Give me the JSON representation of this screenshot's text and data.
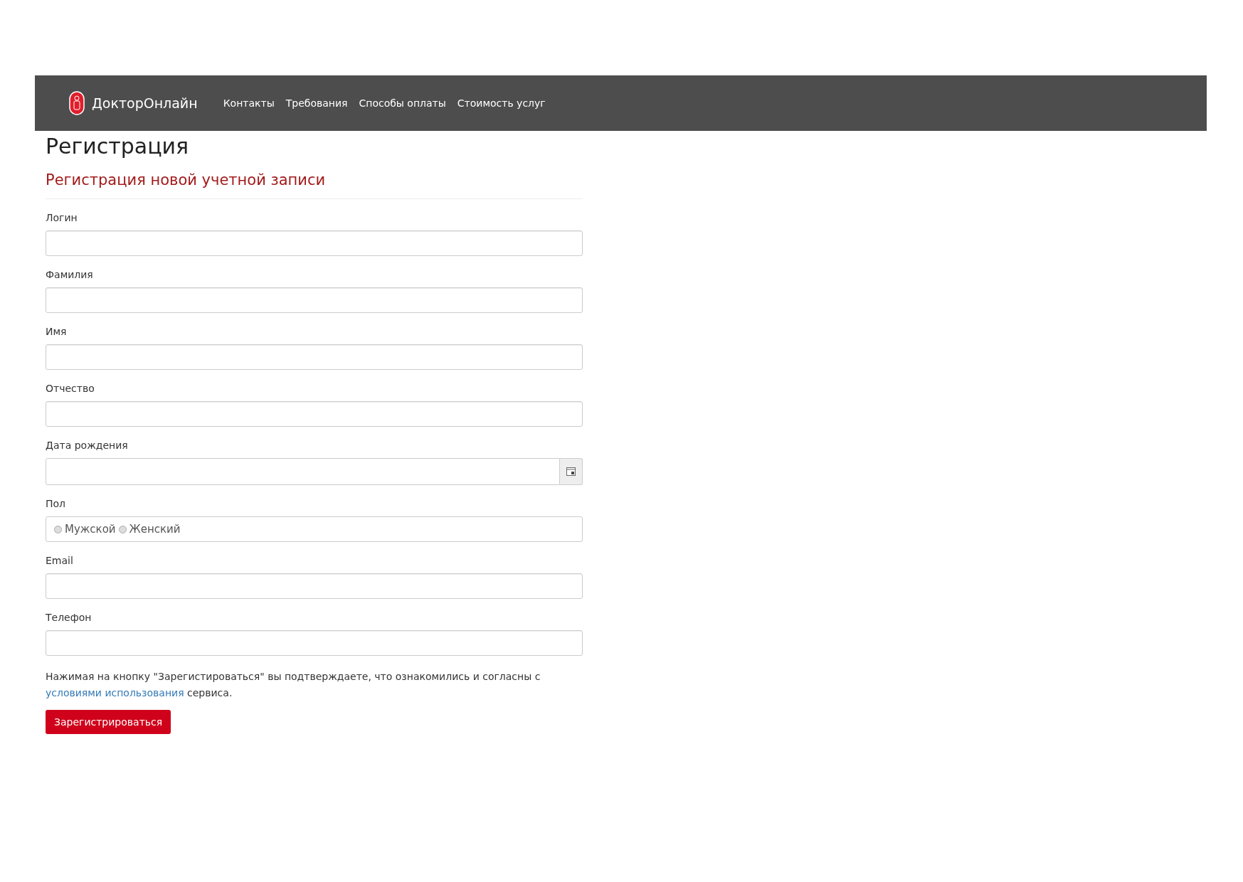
{
  "navbar": {
    "brand": "ДокторОнлайн",
    "links": [
      "Контакты",
      "Требования",
      "Способы оплаты",
      "Стоимость услуг"
    ]
  },
  "page_title": "Регистрация",
  "form": {
    "title": "Регистрация новой учетной записи",
    "fields": [
      {
        "kind": "text",
        "label": "Логин"
      },
      {
        "kind": "text",
        "label": "Фамилия"
      },
      {
        "kind": "text",
        "label": "Имя"
      },
      {
        "kind": "text",
        "label": "Отчество"
      },
      {
        "kind": "date",
        "label": "Дата рождения"
      },
      {
        "kind": "radio",
        "label": "Пол",
        "options": [
          {
            "label": "Мужской",
            "selected": false
          },
          {
            "label": "Женский",
            "selected": false
          }
        ]
      },
      {
        "kind": "text",
        "label": "Email"
      },
      {
        "kind": "text",
        "label": "Телефон"
      }
    ],
    "notice": {
      "before": "Нажимая на кнопку \"Зарегистироваться\" вы подтверждаете, что ознакомились и согласны с",
      "link": "условиями использования",
      "after": "сервиса."
    },
    "submit": "Зарегистрироваться"
  }
}
